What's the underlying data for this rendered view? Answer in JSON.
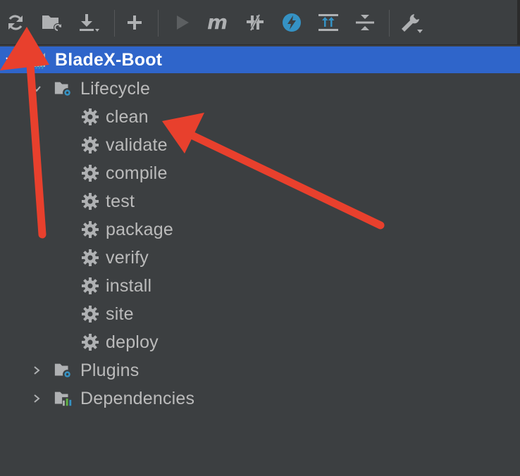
{
  "toolbar": {
    "icons": [
      {
        "name": "reload-all-maven-projects-icon"
      },
      {
        "name": "generate-sources-folder-icon"
      },
      {
        "name": "download-sources-icon"
      },
      {
        "name": "add-maven-project-icon"
      },
      {
        "name": "run-maven-build-icon"
      },
      {
        "name": "execute-maven-goal-icon"
      },
      {
        "name": "toggle-offline-mode-icon"
      },
      {
        "name": "skip-tests-icon"
      },
      {
        "name": "show-dependencies-icon"
      },
      {
        "name": "collapse-all-icon"
      },
      {
        "name": "maven-settings-icon"
      }
    ]
  },
  "tree": {
    "project": "BladeX-Boot",
    "lifecycle": {
      "label": "Lifecycle",
      "goals": [
        "clean",
        "validate",
        "compile",
        "test",
        "package",
        "verify",
        "install",
        "site",
        "deploy"
      ]
    },
    "plugins": "Plugins",
    "dependencies": "Dependencies"
  },
  "colors": {
    "background": "#3c3f41",
    "selection": "#2f65ca",
    "text": "#bbbbbb",
    "annotation": "#e8402d"
  }
}
